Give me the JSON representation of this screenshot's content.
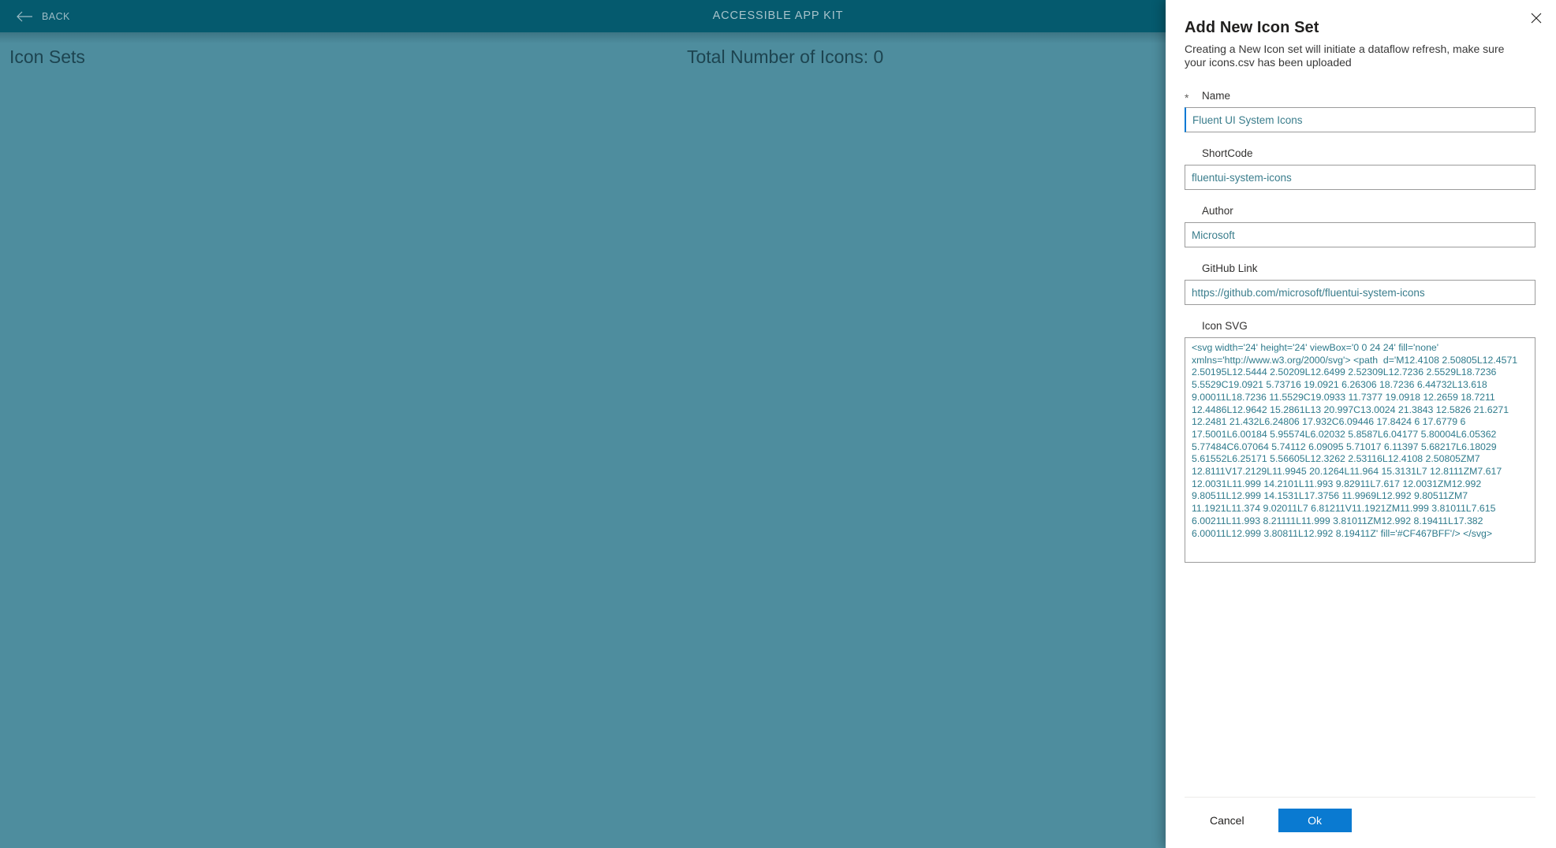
{
  "app": {
    "topbar": {
      "back_label": "BACK",
      "back_icon": "arrow-left-icon",
      "title": "ACCESSIBLE APP KIT"
    },
    "subheader": {
      "heading": "Icon Sets",
      "total_icons_label": "Total Number of Icons: 0"
    },
    "colors": {
      "topbar_bg": "#055a6e",
      "page_bg": "#4e8d9e",
      "heading_text": "#1d4450",
      "topbar_text": "#a8c3cb"
    }
  },
  "panel": {
    "close_icon": "close-icon",
    "title": "Add New Icon Set",
    "subtitle": "Creating a New Icon set will initiate a dataflow refresh, make sure your icons.csv has been uploaded",
    "fields": [
      {
        "name": "name",
        "label": "Name",
        "required_marker": "*",
        "value": "Fluent UI System Icons",
        "placeholder": "",
        "focused": true
      },
      {
        "name": "shortcode",
        "label": "ShortCode",
        "required_marker": "",
        "value": "fluentui-system-icons",
        "placeholder": "",
        "focused": false
      },
      {
        "name": "author",
        "label": "Author",
        "required_marker": "",
        "value": "Microsoft",
        "placeholder": "",
        "focused": false
      },
      {
        "name": "github-link",
        "label": "GitHub Link",
        "required_marker": "",
        "value": "https://github.com/microsoft/fluentui-system-icons",
        "placeholder": "",
        "focused": false
      }
    ],
    "svg_field": {
      "label": "Icon SVG",
      "value": "<svg width='24' height='24' viewBox='0 0 24 24' fill='none' xmlns='http://www.w3.org/2000/svg'> <path  d='M12.4108 2.50805L12.4571 2.50195L12.5444 2.50209L12.6499 2.52309L12.7236 2.5529L18.7236 5.5529C19.0921 5.73716 19.0921 6.26306 18.7236 6.44732L13.618 9.00011L18.7236 11.5529C19.0933 11.7377 19.0918 12.2659 18.7211 12.4486L12.9642 15.2861L13 20.997C13.0024 21.3843 12.5826 21.6271 12.2481 21.432L6.24806 17.932C6.09446 17.8424 6 17.6779 6 17.5001L6.00184 5.95574L6.02032 5.8587L6.04177 5.80004L6.05362 5.77484C6.07064 5.74112 6.09095 5.71017 6.11397 5.68217L6.18029 5.61552L6.25171 5.56605L12.3262 2.53116L12.4108 2.50805ZM7 12.8111V17.2129L11.9945 20.1264L11.964 15.3131L7 12.8111ZM7.617 12.0031L11.999 14.2101L11.993 9.82911L7.617 12.0031ZM12.992 9.80511L12.999 14.1531L17.3756 11.9969L12.992 9.80511ZM7 11.1921L11.374 9.02011L7 6.81211V11.1921ZM11.999 3.81011L7.615 6.00211L11.993 8.21111L11.999 3.81011ZM12.992 8.19411L17.382 6.00011L12.999 3.80811L12.992 8.19411Z' fill='#CF467BFF'/> </svg>"
    },
    "footer": {
      "cancel_label": "Cancel",
      "ok_label": "Ok",
      "ok_color": "#0a7ad1"
    }
  }
}
